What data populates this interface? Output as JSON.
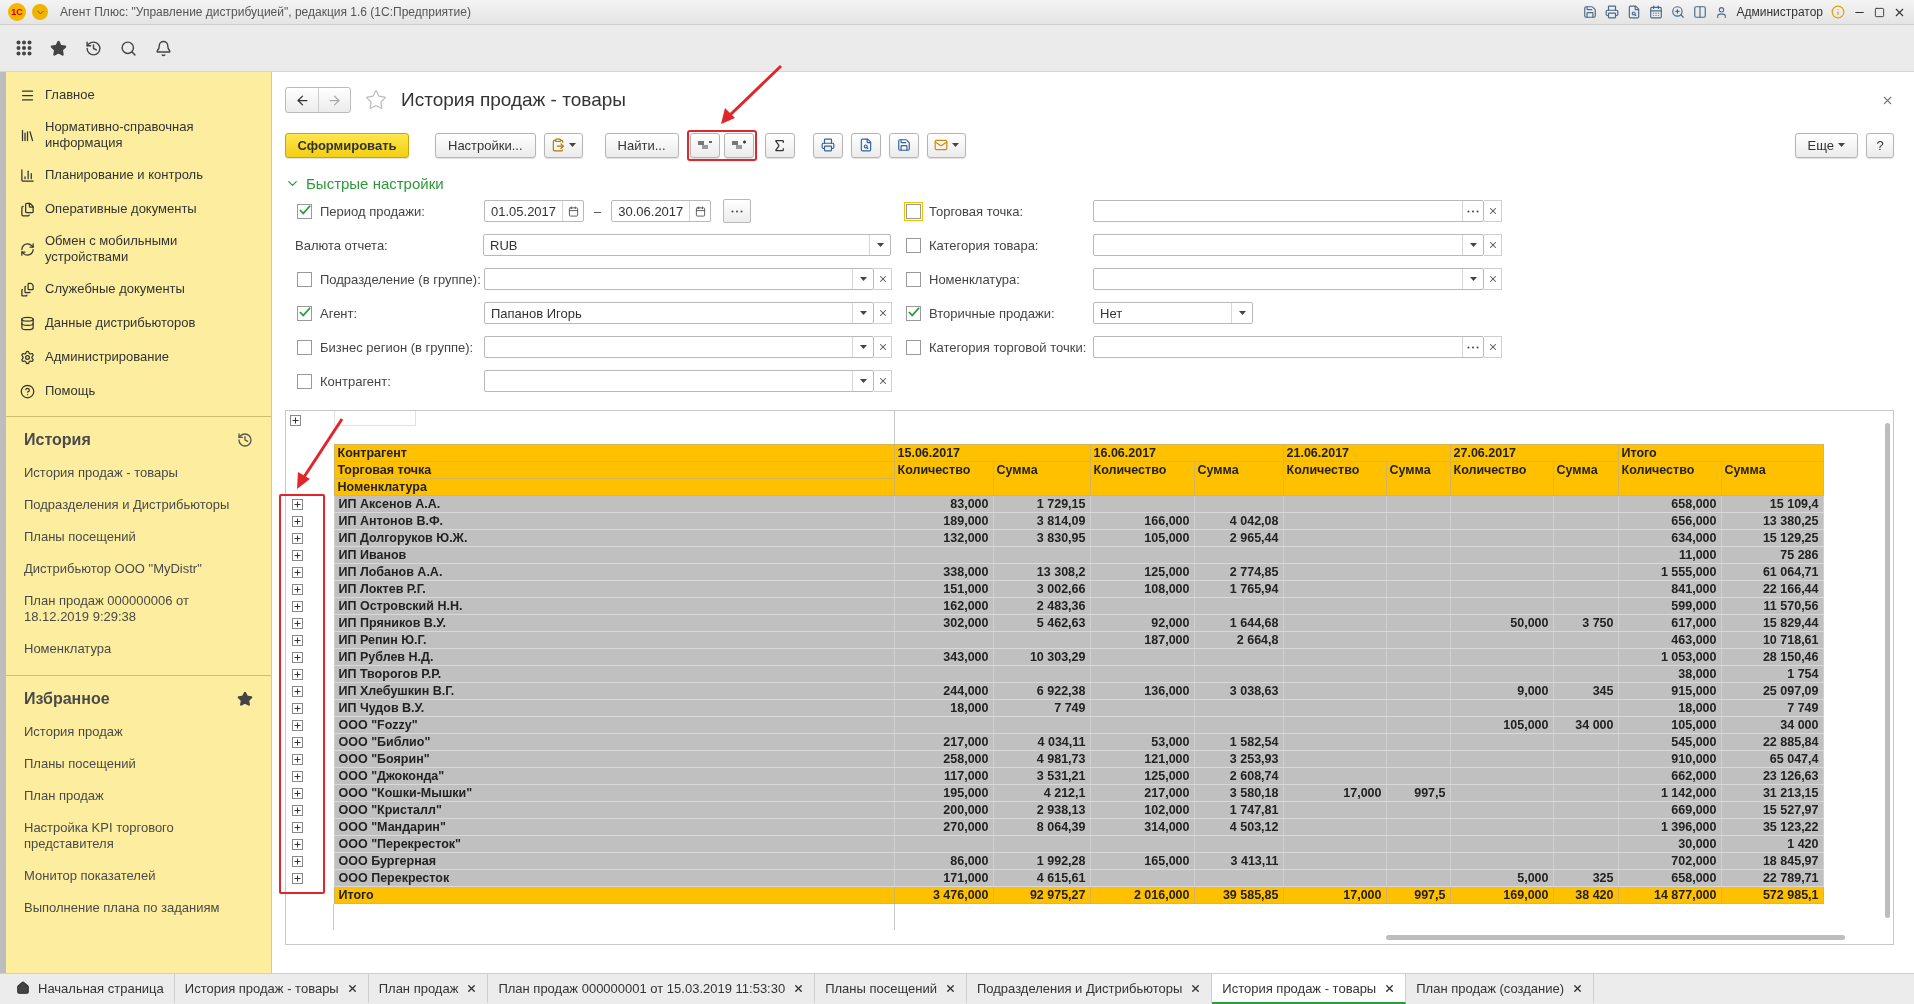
{
  "app": {
    "logo": "1С",
    "title": "Агент Плюс: \"Управление дистрибуцией\", редакция 1.6  (1С:Предприятие)",
    "user": "Администратор"
  },
  "sidebar": {
    "sections": [
      {
        "label": "Главное"
      },
      {
        "label": "Нормативно-справочная информация"
      },
      {
        "label": "Планирование и контроль"
      },
      {
        "label": "Оперативные документы"
      },
      {
        "label": "Обмен с мобильными устройствами"
      },
      {
        "label": "Служебные документы"
      },
      {
        "label": "Данные дистрибьюторов"
      },
      {
        "label": "Администрирование"
      },
      {
        "label": "Помощь"
      }
    ],
    "history": {
      "title": "История",
      "items": [
        "История продаж - товары",
        "Подразделения и Дистрибьюторы",
        "Планы посещений",
        "Дистрибьютор ООО \"MyDistr\"",
        "План продаж 000000006 от 18.12.2019 9:29:38",
        "Номенклатура"
      ]
    },
    "favorites": {
      "title": "Избранное",
      "items": [
        "История продаж",
        "Планы посещений",
        "План продаж",
        "Настройка KPI торгового представителя",
        "Монитор показателей",
        "Выполнение плана по заданиям"
      ]
    }
  },
  "form": {
    "title": "История продаж - товары",
    "toolbar": {
      "generate": "Сформировать",
      "settings": "Настройки...",
      "find": "Найти...",
      "more": "Еще",
      "help": "?"
    }
  },
  "quick_settings": {
    "title": "Быстрые настройки",
    "expanded": true,
    "left": [
      {
        "kind": "period",
        "label": "Период продажи:",
        "checked": true,
        "focused": false,
        "from": "01.05.2017",
        "separator": "–",
        "to": "30.06.2017"
      },
      {
        "kind": "select",
        "label": "Валюта отчета:",
        "value": "RUB",
        "clearable": false
      },
      {
        "kind": "select",
        "label": "Подразделение (в группе):",
        "checked": false,
        "focused": false,
        "clearable": true
      },
      {
        "kind": "select",
        "label": "Агент:",
        "checked": true,
        "focused": false,
        "value": "Папанов Игорь",
        "clearable": true
      },
      {
        "kind": "select",
        "label": "Бизнес регион (в группе):",
        "checked": false,
        "focused": false,
        "clearable": true
      },
      {
        "kind": "select",
        "label": "Контрагент:",
        "checked": false,
        "focused": false,
        "clearable": true
      }
    ],
    "right": [
      {
        "kind": "choice",
        "label": "Торговая точка:",
        "checked": false,
        "focused": true,
        "clearable": true
      },
      {
        "kind": "select",
        "label": "Категория товара:",
        "checked": false,
        "focused": false,
        "clearable": true
      },
      {
        "kind": "select",
        "label": "Номенклатура:",
        "checked": false,
        "focused": false,
        "clearable": true
      },
      {
        "kind": "short",
        "label": "Вторичные продажи:",
        "checked": true,
        "focused": false,
        "value": "Нет",
        "clearable": false
      },
      {
        "kind": "choice",
        "label": "Категория торговой точки:",
        "checked": false,
        "focused": false,
        "clearable": true
      }
    ]
  },
  "report": {
    "row_headers": [
      "Контрагент",
      "Торговая точка",
      "Номенклатура"
    ],
    "groups": [
      {
        "label": "15.06.2017",
        "columns": [
          "Количество",
          "Сумма"
        ]
      },
      {
        "label": "16.06.2017",
        "columns": [
          "Количество",
          "Сумма"
        ]
      },
      {
        "label": "21.06.2017",
        "columns": [
          "Количество",
          "Сумма"
        ]
      },
      {
        "label": "27.06.2017",
        "columns": [
          "Количество",
          "Сумма"
        ]
      },
      {
        "label": "Итого",
        "columns": [
          "Количество",
          "Сумма"
        ]
      }
    ],
    "rows": [
      {
        "name": "ИП Аксенов А.А.",
        "expanded": false,
        "cells": {
          "c1": "83,000",
          "c2": "1 729,15",
          "c9": "658,000",
          "c10": "15 109,4"
        }
      },
      {
        "name": "ИП Антонов В.Ф.",
        "expanded": false,
        "cells": {
          "c1": "189,000",
          "c2": "3 814,09",
          "c3": "166,000",
          "c4": "4 042,08",
          "c9": "656,000",
          "c10": "13 380,25"
        }
      },
      {
        "name": "ИП Долгоруков Ю.Ж.",
        "expanded": false,
        "cells": {
          "c1": "132,000",
          "c2": "3 830,95",
          "c3": "105,000",
          "c4": "2 965,44",
          "c9": "634,000",
          "c10": "15 129,25"
        }
      },
      {
        "name": "ИП Иванов",
        "expanded": false,
        "cells": {
          "c9": "11,000",
          "c10": "75 286"
        }
      },
      {
        "name": "ИП Лобанов А.А.",
        "expanded": false,
        "cells": {
          "c1": "338,000",
          "c2": "13 308,2",
          "c3": "125,000",
          "c4": "2 774,85",
          "c9": "1 555,000",
          "c10": "61 064,71"
        }
      },
      {
        "name": "ИП Локтев Р.Г.",
        "expanded": false,
        "cells": {
          "c1": "151,000",
          "c2": "3 002,66",
          "c3": "108,000",
          "c4": "1 765,94",
          "c9": "841,000",
          "c10": "22 166,44"
        }
      },
      {
        "name": "ИП Островский Н.Н.",
        "expanded": false,
        "cells": {
          "c1": "162,000",
          "c2": "2 483,36",
          "c9": "599,000",
          "c10": "11 570,56"
        }
      },
      {
        "name": "ИП Пряников В.У.",
        "expanded": false,
        "cells": {
          "c1": "302,000",
          "c2": "5 462,63",
          "c3": "92,000",
          "c4": "1 644,68",
          "c7": "50,000",
          "c8": "3 750",
          "c9": "617,000",
          "c10": "15 829,44"
        }
      },
      {
        "name": "ИП Репин Ю.Г.",
        "expanded": false,
        "cells": {
          "c3": "187,000",
          "c4": "2 664,8",
          "c9": "463,000",
          "c10": "10 718,61"
        }
      },
      {
        "name": "ИП Рублев Н.Д.",
        "expanded": false,
        "cells": {
          "c1": "343,000",
          "c2": "10 303,29",
          "c9": "1 053,000",
          "c10": "28 150,46"
        }
      },
      {
        "name": "ИП Творогов Р.Р.",
        "expanded": false,
        "cells": {
          "c9": "38,000",
          "c10": "1 754"
        }
      },
      {
        "name": "ИП Хлебушкин В.Г.",
        "expanded": false,
        "cells": {
          "c1": "244,000",
          "c2": "6 922,38",
          "c3": "136,000",
          "c4": "3 038,63",
          "c7": "9,000",
          "c8": "345",
          "c9": "915,000",
          "c10": "25 097,09"
        }
      },
      {
        "name": "ИП Чудов В.У.",
        "expanded": false,
        "cells": {
          "c1": "18,000",
          "c2": "7 749",
          "c9": "18,000",
          "c10": "7 749"
        }
      },
      {
        "name": "ООО \"Fozzy\"",
        "expanded": false,
        "cells": {
          "c7": "105,000",
          "c8": "34 000",
          "c9": "105,000",
          "c10": "34 000"
        }
      },
      {
        "name": "ООО \"Библио\"",
        "expanded": false,
        "cells": {
          "c1": "217,000",
          "c2": "4 034,11",
          "c3": "53,000",
          "c4": "1 582,54",
          "c9": "545,000",
          "c10": "22 885,84"
        }
      },
      {
        "name": "ООО \"Боярин\"",
        "expanded": false,
        "cells": {
          "c1": "258,000",
          "c2": "4 981,73",
          "c3": "121,000",
          "c4": "3 253,93",
          "c9": "910,000",
          "c10": "65 047,4"
        }
      },
      {
        "name": "ООО \"Джоконда\"",
        "expanded": false,
        "cells": {
          "c1": "117,000",
          "c2": "3 531,21",
          "c3": "125,000",
          "c4": "2 608,74",
          "c9": "662,000",
          "c10": "23 126,63"
        }
      },
      {
        "name": "ООО \"Кошки-Мышки\"",
        "expanded": false,
        "cells": {
          "c1": "195,000",
          "c2": "4 212,1",
          "c3": "217,000",
          "c4": "3 580,18",
          "c5": "17,000",
          "c6": "997,5",
          "c9": "1 142,000",
          "c10": "31 213,15"
        }
      },
      {
        "name": "ООО \"Кристалл\"",
        "expanded": false,
        "cells": {
          "c1": "200,000",
          "c2": "2 938,13",
          "c3": "102,000",
          "c4": "1 747,81",
          "c9": "669,000",
          "c10": "15 527,97"
        }
      },
      {
        "name": "ООО \"Мандарин\"",
        "expanded": false,
        "cells": {
          "c1": "270,000",
          "c2": "8 064,39",
          "c3": "314,000",
          "c4": "4 503,12",
          "c9": "1 396,000",
          "c10": "35 123,22"
        }
      },
      {
        "name": "ООО \"Перекресток\"",
        "expanded": false,
        "cells": {
          "c9": "30,000",
          "c10": "1 420"
        }
      },
      {
        "name": "ООО Бургерная",
        "expanded": false,
        "cells": {
          "c1": "86,000",
          "c2": "1 992,28",
          "c3": "165,000",
          "c4": "3 413,11",
          "c9": "702,000",
          "c10": "18 845,97"
        }
      },
      {
        "name": "ООО Перекресток",
        "expanded": false,
        "cells": {
          "c1": "171,000",
          "c2": "4 615,61",
          "c7": "5,000",
          "c8": "325",
          "c9": "658,000",
          "c10": "22 789,71"
        }
      }
    ],
    "total": {
      "label": "Итого",
      "cells": {
        "c1": "3 476,000",
        "c2": "92 975,27",
        "c3": "2 016,000",
        "c4": "39 585,85",
        "c5": "17,000",
        "c6": "997,5",
        "c7": "169,000",
        "c8": "38 420",
        "c9": "14 877,000",
        "c10": "572 985,1"
      }
    }
  },
  "tabs": [
    {
      "kind": "home",
      "label": "Начальная страница",
      "selected": false
    },
    {
      "kind": "page",
      "label": "История продаж - товары",
      "selected": false
    },
    {
      "kind": "page",
      "label": "План продаж",
      "selected": false
    },
    {
      "kind": "page",
      "label": "План продаж 000000001 от 15.03.2019 11:53:30",
      "selected": false
    },
    {
      "kind": "page",
      "label": "Планы посещений",
      "selected": false
    },
    {
      "kind": "page",
      "label": "Подразделения и Дистрибьюторы",
      "selected": false
    },
    {
      "kind": "page",
      "label": "История продаж - товары",
      "selected": true
    },
    {
      "kind": "page",
      "label": "План продаж (создание)",
      "selected": false
    }
  ]
}
